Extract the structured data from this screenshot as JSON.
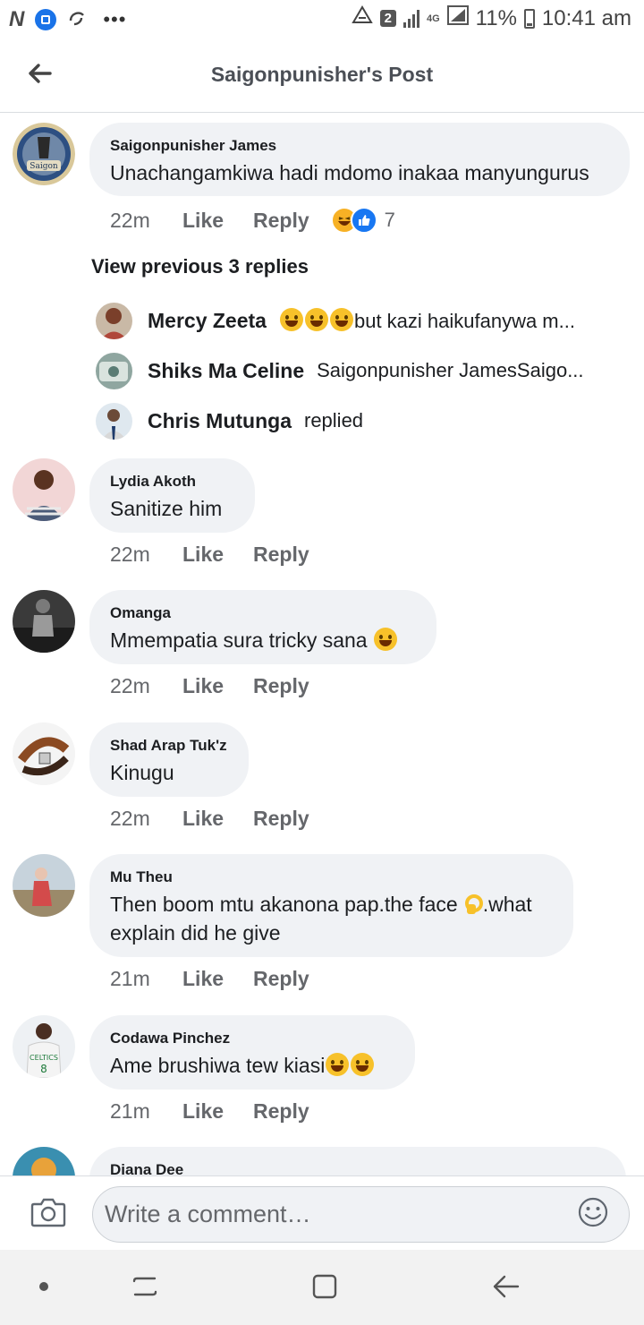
{
  "status_bar": {
    "carrier_icons": [
      "N",
      "app-icon",
      "sync-icon"
    ],
    "more": "•••",
    "sim_badge": "2",
    "network": "4G",
    "battery": "11%",
    "time": "10:41 am"
  },
  "header": {
    "title": "Saigonpunisher's Post"
  },
  "main_comment": {
    "author": "Saigonpunisher James",
    "text": "Unachangamkiwa hadi mdomo inakaa manyungurus",
    "time": "22m",
    "like": "Like",
    "reply": "Reply",
    "reaction_count": "7"
  },
  "view_previous": "View previous 3 replies",
  "replies": [
    {
      "name": "Mercy Zeeta",
      "text": "but kazi haikufanywa m..."
    },
    {
      "name": "Shiks Ma Celine",
      "text": "Saigonpunisher JamesSaigo..."
    },
    {
      "name": "Chris Mutunga",
      "text": "replied"
    }
  ],
  "comments": [
    {
      "author": "Lydia Akoth",
      "text": "Sanitize him",
      "time": "22m",
      "like": "Like",
      "reply": "Reply"
    },
    {
      "author": "Omanga",
      "text": "Mmempatia sura tricky sana",
      "time": "22m",
      "like": "Like",
      "reply": "Reply"
    },
    {
      "author": "Shad Arap Tuk'z",
      "text": "Kinugu",
      "time": "22m",
      "like": "Like",
      "reply": "Reply"
    },
    {
      "author": "Mu Theu",
      "text": "Then boom mtu akanona pap.the face",
      "text2": ".what explain did he give",
      "time": "21m",
      "like": "Like",
      "reply": "Reply"
    },
    {
      "author": "Codawa Pinchez",
      "text": "Ame brushiwa tew kiasi",
      "time": "21m",
      "like": "Like",
      "reply": "Reply"
    },
    {
      "author": "Diana Dee",
      "text": ""
    }
  ],
  "composer": {
    "placeholder": "Write a comment…"
  },
  "colors": {
    "bubble": "#f0f2f5",
    "meta_text": "#65676b",
    "like_blue": "#1877f2",
    "haha_yellow": "#f7b125"
  }
}
